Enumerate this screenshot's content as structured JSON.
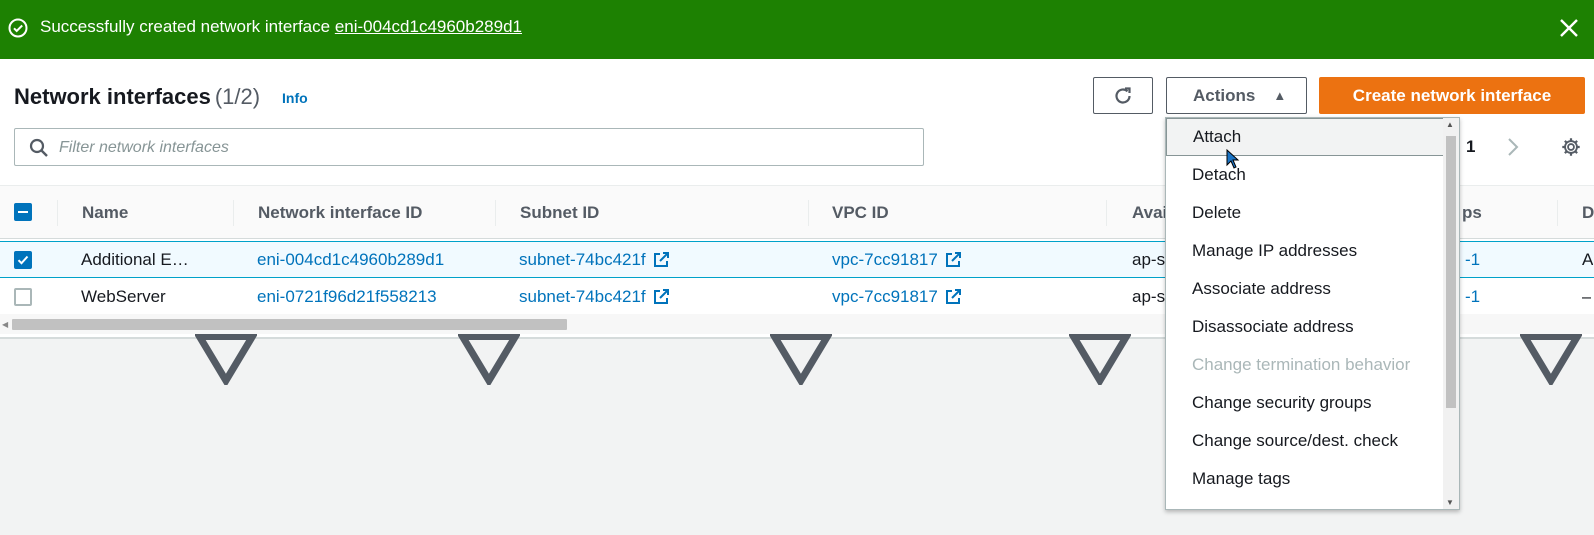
{
  "flash": {
    "message": "Successfully created network interface",
    "link": "eni-004cd1c4960b289d1"
  },
  "header": {
    "title": "Network interfaces",
    "count": "(1/2)",
    "info": "Info"
  },
  "toolbar": {
    "actions_label": "Actions",
    "create_label": "Create network interface"
  },
  "search": {
    "placeholder": "Filter network interfaces"
  },
  "pagination": {
    "page": "1"
  },
  "table": {
    "columns": [
      "Name",
      "Network interface ID",
      "Subnet ID",
      "VPC ID",
      "Avai",
      "ps",
      "D"
    ],
    "rows": [
      {
        "name": "Additional E…",
        "eni": "eni-004cd1c4960b289d1",
        "subnet": "subnet-74bc421f",
        "vpc": "vpc-7cc91817",
        "az": "ap-s",
        "sg": "-1",
        "d": "A",
        "selected": true
      },
      {
        "name": "WebServer",
        "eni": "eni-0721f96d21f558213",
        "subnet": "subnet-74bc421f",
        "vpc": "vpc-7cc91817",
        "az": "ap-s",
        "sg": "-1",
        "d": "–",
        "selected": false
      }
    ]
  },
  "actions_menu": {
    "items": [
      {
        "label": "Attach",
        "state": "hover"
      },
      {
        "label": "Detach",
        "state": "normal"
      },
      {
        "label": "Delete",
        "state": "normal"
      },
      {
        "label": "Manage IP addresses",
        "state": "normal"
      },
      {
        "label": "Associate address",
        "state": "normal"
      },
      {
        "label": "Disassociate address",
        "state": "normal"
      },
      {
        "label": "Change termination behavior",
        "state": "disabled"
      },
      {
        "label": "Change security groups",
        "state": "normal"
      },
      {
        "label": "Change source/dest. check",
        "state": "normal"
      },
      {
        "label": "Manage tags",
        "state": "normal"
      }
    ]
  },
  "colors": {
    "success": "#1d8102",
    "primary": "#ec7211",
    "link": "#0073bb"
  },
  "icons": {
    "flash": "check-circle-icon",
    "close": "close-icon",
    "refresh": "refresh-icon",
    "caret": "caret-up-icon",
    "search": "search-icon",
    "next": "chevron-right-icon",
    "settings": "gear-icon",
    "filter": "sort-caret-icon",
    "external": "external-link-icon"
  }
}
